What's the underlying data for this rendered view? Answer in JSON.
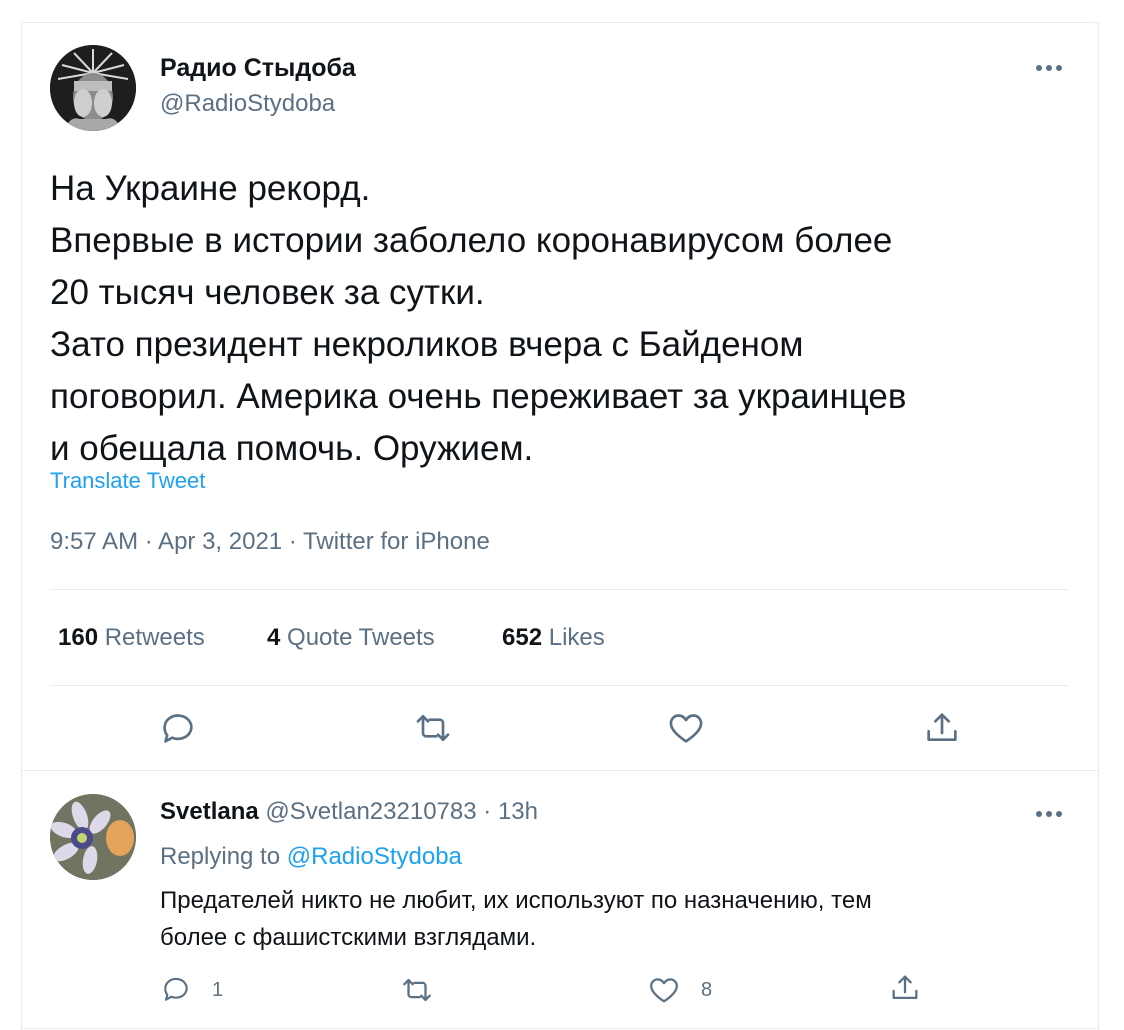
{
  "tweet": {
    "author_name": "Радио Стыдоба",
    "author_handle": "@RadioStydoba",
    "text_lines": [
      "На Украине рекорд.",
      "Впервые в истории заболело коронавирусом более",
      "20 тысяч человек за сутки.",
      "Зато президент некроликов вчера с Байденом",
      "поговорил. Америка очень переживает за украинцев",
      "и обещала помочь. Оружием."
    ],
    "translate_label": "Translate Tweet",
    "meta": "9:57 AM · Apr 3, 2021 · Twitter for iPhone",
    "stats": {
      "retweets_count": "160",
      "retweets_label": "Retweets",
      "quotes_count": "4",
      "quotes_label": "Quote Tweets",
      "likes_count": "652",
      "likes_label": "Likes"
    },
    "icons": [
      "more-icon",
      "reply-icon",
      "retweet-icon",
      "like-icon",
      "share-icon"
    ]
  },
  "reply": {
    "author_name": "Svetlana",
    "author_handle": "@Svetlan23210783",
    "time": "13h",
    "replying_prefix": "Replying to",
    "replying_to": "@RadioStydoba",
    "text_lines": [
      "Предателей никто не любит, их используют по назначению, тем",
      "более с фашистскими взглядами."
    ],
    "reply_count": "1",
    "like_count": "8"
  },
  "colors": {
    "accent": "#1da1f2",
    "secondary_text": "#5b7083",
    "primary_text": "#0f1419",
    "divider": "#e6ecf0"
  }
}
